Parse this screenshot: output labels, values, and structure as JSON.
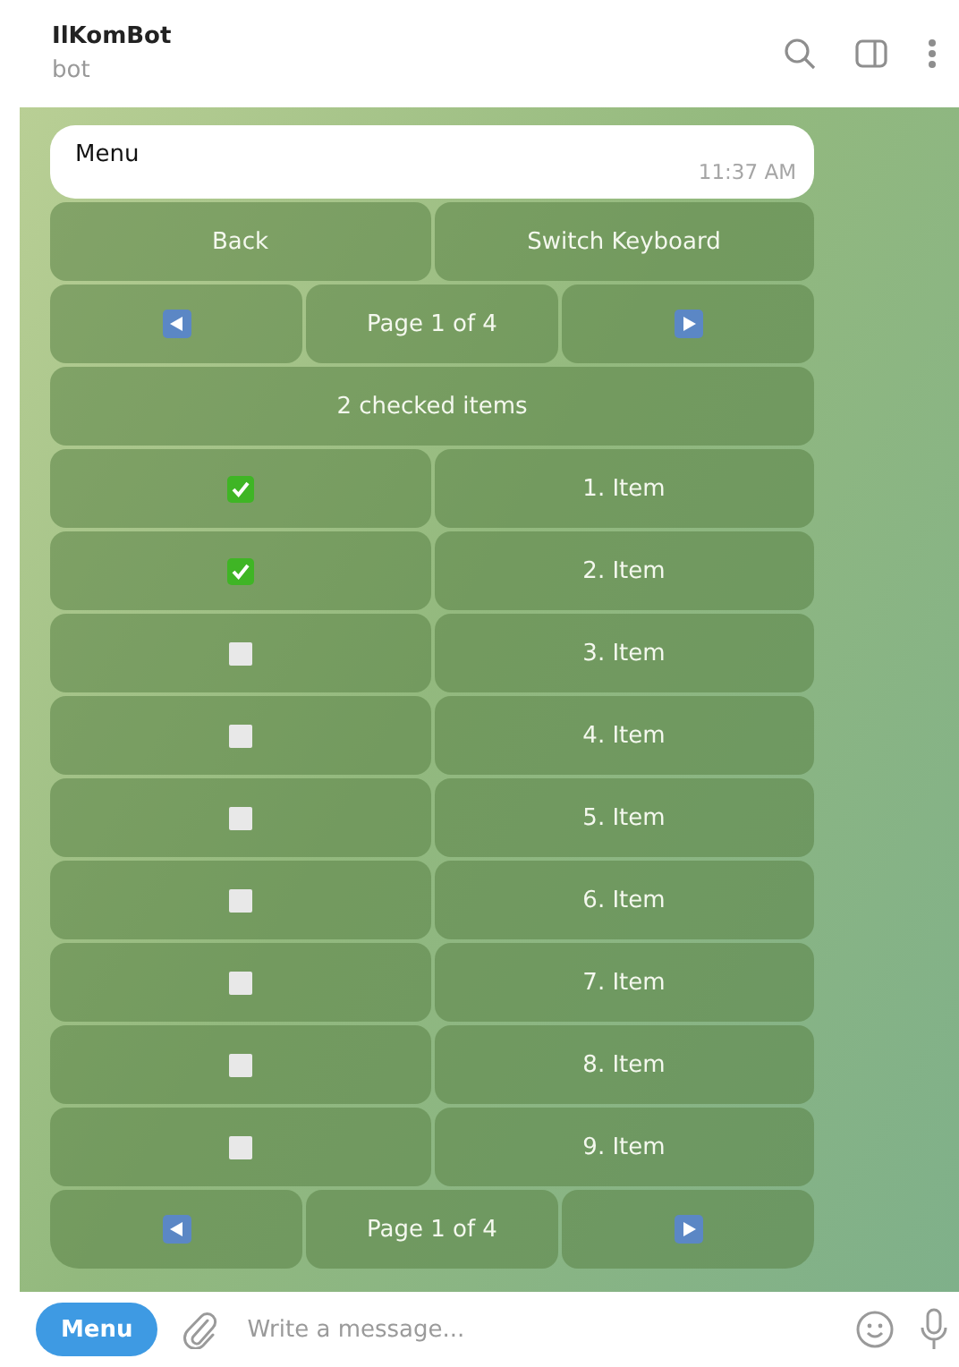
{
  "header": {
    "title": "IlKomBot",
    "subtitle": "bot"
  },
  "message": {
    "text": "Menu",
    "time": "11:37 AM"
  },
  "keyboard": [
    {
      "buttons": [
        {
          "kind": "text",
          "label": "Back"
        },
        {
          "kind": "text",
          "label": "Switch Keyboard"
        }
      ]
    },
    {
      "buttons": [
        {
          "kind": "prev"
        },
        {
          "kind": "text",
          "label": "Page 1 of 4"
        },
        {
          "kind": "next"
        }
      ]
    },
    {
      "buttons": [
        {
          "kind": "text",
          "label": "2 checked items"
        }
      ]
    },
    {
      "buttons": [
        {
          "kind": "check",
          "checked": true
        },
        {
          "kind": "text",
          "label": "1. Item"
        }
      ]
    },
    {
      "buttons": [
        {
          "kind": "check",
          "checked": true
        },
        {
          "kind": "text",
          "label": "2. Item"
        }
      ]
    },
    {
      "buttons": [
        {
          "kind": "check",
          "checked": false
        },
        {
          "kind": "text",
          "label": "3. Item"
        }
      ]
    },
    {
      "buttons": [
        {
          "kind": "check",
          "checked": false
        },
        {
          "kind": "text",
          "label": "4. Item"
        }
      ]
    },
    {
      "buttons": [
        {
          "kind": "check",
          "checked": false
        },
        {
          "kind": "text",
          "label": "5. Item"
        }
      ]
    },
    {
      "buttons": [
        {
          "kind": "check",
          "checked": false
        },
        {
          "kind": "text",
          "label": "6. Item"
        }
      ]
    },
    {
      "buttons": [
        {
          "kind": "check",
          "checked": false
        },
        {
          "kind": "text",
          "label": "7. Item"
        }
      ]
    },
    {
      "buttons": [
        {
          "kind": "check",
          "checked": false
        },
        {
          "kind": "text",
          "label": "8. Item"
        }
      ]
    },
    {
      "buttons": [
        {
          "kind": "check",
          "checked": false
        },
        {
          "kind": "text",
          "label": "9. Item"
        }
      ]
    },
    {
      "buttons": [
        {
          "kind": "prev"
        },
        {
          "kind": "text",
          "label": "Page 1 of 4"
        },
        {
          "kind": "next"
        }
      ]
    }
  ],
  "composer": {
    "menu_button": "Menu",
    "placeholder": "Write a message..."
  }
}
